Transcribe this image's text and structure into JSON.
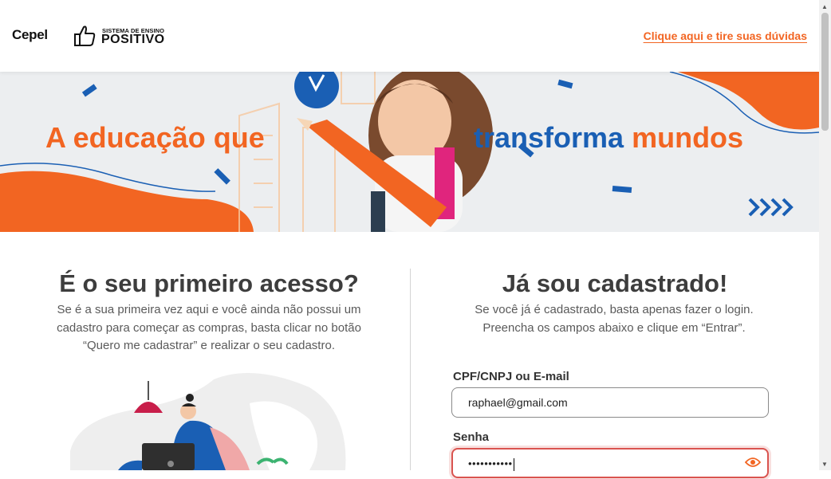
{
  "header": {
    "brand_cepel": "Cepel",
    "brand_positivo_small": "SISTEMA DE ENSINO",
    "brand_positivo_big": "POSITIVO",
    "help_link": "Clique aqui e tire suas dúvidas"
  },
  "banner": {
    "text_left": "A educação que",
    "text_right_1": "transforma",
    "text_right_2": "mundos",
    "arrows": "»»»»"
  },
  "first_access": {
    "title": "É o seu primeiro acesso?",
    "description": "Se é a sua primeira vez aqui e você ainda não possui um cadastro para começar as compras, basta clicar no botão “Quero me cadastrar” e realizar o seu cadastro."
  },
  "login": {
    "title": "Já sou cadastrado!",
    "description_1": "Se você já é cadastrado, basta apenas fazer o login.",
    "description_2": "Preencha os campos abaixo e clique em “Entrar”.",
    "email_label": "CPF/CNPJ ou E-mail",
    "email_value": "raphael@gmail.com",
    "password_label": "Senha",
    "password_value": "•••••••••••"
  },
  "colors": {
    "accent_orange": "#f26522",
    "accent_blue": "#1a5fb4",
    "error_border": "#d9534f"
  },
  "icons": [
    "positivo-thumb-icon",
    "eye-icon",
    "chevron-arrows-icon",
    "scroll-up-icon",
    "scroll-down-icon"
  ]
}
